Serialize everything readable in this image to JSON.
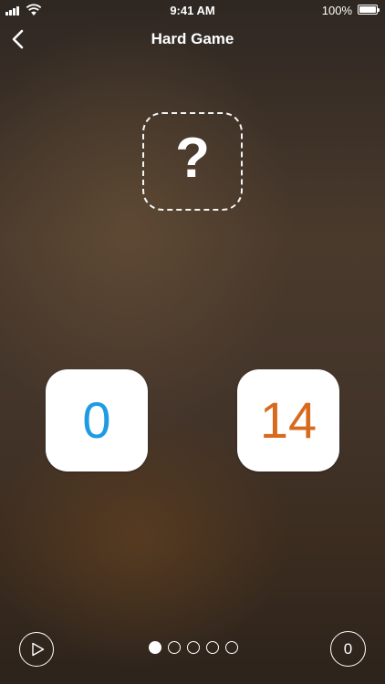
{
  "status_bar": {
    "time": "9:41 AM",
    "battery_percent": "100%",
    "signal_icon": "signal-bars-icon",
    "wifi_icon": "wifi-icon",
    "battery_icon": "battery-icon"
  },
  "nav": {
    "back_icon": "chevron-left-icon",
    "title": "Hard Game"
  },
  "mystery": {
    "symbol": "?"
  },
  "tiles": [
    {
      "value": "0",
      "color": "#1e9be3"
    },
    {
      "value": "14",
      "color": "#d86a1e"
    }
  ],
  "bottom_bar": {
    "play_icon": "play-icon",
    "score": "0",
    "pages": {
      "total": 5,
      "current": 1
    }
  }
}
